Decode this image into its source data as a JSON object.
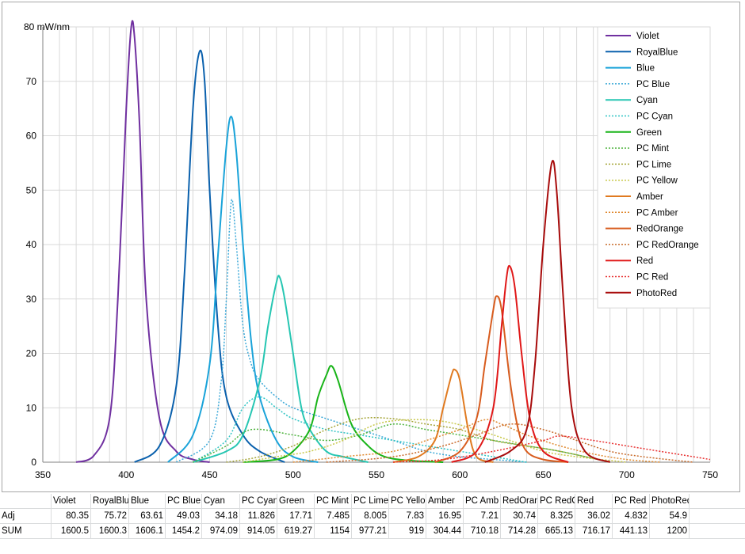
{
  "chart_data": {
    "type": "line",
    "title": "",
    "xlabel": "",
    "ylabel": "mW/nm",
    "y_top_tick_label": "80 mW/nm",
    "xlim": [
      350,
      750
    ],
    "ylim": [
      0,
      80
    ],
    "x_ticks": [
      "350",
      "400",
      "450",
      "500",
      "550",
      "600",
      "650",
      "700",
      "750"
    ],
    "y_ticks": [
      "0",
      "10",
      "20",
      "30",
      "40",
      "50",
      "60",
      "70",
      "80 mW/nm"
    ],
    "grid": true,
    "legend_position": "top-right",
    "series": [
      {
        "name": "Violet",
        "color": "#7030a0",
        "dash": "solid",
        "x": [
          370,
          380,
          390,
          395,
          400,
          403,
          405,
          408,
          412,
          420,
          430,
          440,
          450
        ],
        "y": [
          0,
          1,
          8,
          30,
          65,
          80,
          78,
          62,
          30,
          8,
          2,
          0.5,
          0
        ]
      },
      {
        "name": "RoyalBlue",
        "color": "#0b61ad",
        "dash": "solid",
        "x": [
          405,
          420,
          430,
          435,
          440,
          444,
          447,
          450,
          455,
          460,
          470,
          480,
          495
        ],
        "y": [
          0,
          3,
          14,
          35,
          65,
          75.5,
          70,
          50,
          25,
          12,
          5,
          2,
          0
        ]
      },
      {
        "name": "Blue",
        "color": "#1aa3d9",
        "dash": "solid",
        "x": [
          425,
          440,
          450,
          455,
          460,
          463,
          466,
          470,
          475,
          480,
          490,
          500,
          515
        ],
        "y": [
          0,
          5,
          18,
          38,
          58,
          63.5,
          57,
          40,
          22,
          12,
          4,
          1,
          0
        ]
      },
      {
        "name": "PC Blue",
        "color": "#3da9d8",
        "dash": "dotted",
        "x": [
          430,
          450,
          457,
          460,
          463,
          466,
          470,
          475,
          480,
          490,
          500,
          520,
          540,
          560,
          580,
          600,
          620,
          640
        ],
        "y": [
          0,
          4,
          15,
          30,
          48,
          40,
          25,
          18,
          15,
          12,
          10,
          8,
          6,
          4,
          2,
          1,
          0.5,
          0
        ]
      },
      {
        "name": "Cyan",
        "color": "#26c6b2",
        "dash": "solid",
        "x": [
          440,
          460,
          470,
          480,
          485,
          490,
          492,
          495,
          500,
          505,
          510,
          520,
          530,
          545
        ],
        "y": [
          0,
          2,
          5,
          15,
          25,
          33,
          34,
          30,
          20,
          10,
          6,
          2,
          1,
          0
        ]
      },
      {
        "name": "PC Cyan",
        "color": "#2ec4c4",
        "dash": "dotted",
        "x": [
          440,
          460,
          470,
          480,
          490,
          500,
          520,
          540,
          560,
          580,
          600,
          620,
          640
        ],
        "y": [
          0,
          4,
          10,
          12,
          10,
          8,
          6,
          5,
          4,
          3,
          2,
          1,
          0
        ]
      },
      {
        "name": "Green",
        "color": "#18b418",
        "dash": "solid",
        "x": [
          470,
          490,
          500,
          510,
          515,
          520,
          523,
          527,
          535,
          545,
          555,
          570,
          590
        ],
        "y": [
          0,
          0.5,
          2,
          6,
          12,
          16,
          17.7,
          15,
          7,
          3,
          1,
          0.3,
          0
        ]
      },
      {
        "name": "PC Mint",
        "color": "#4db33d",
        "dash": "dotted",
        "x": [
          440,
          460,
          475,
          500,
          520,
          540,
          560,
          580,
          600,
          620,
          640,
          660,
          690
        ],
        "y": [
          0,
          3,
          6,
          5,
          4,
          5,
          7,
          6,
          5,
          4,
          3,
          2,
          0
        ]
      },
      {
        "name": "PC Lime",
        "color": "#a6a63a",
        "dash": "dotted",
        "x": [
          460,
          480,
          500,
          520,
          540,
          560,
          580,
          600,
          620,
          640,
          660,
          690
        ],
        "y": [
          0,
          1,
          3,
          6,
          8,
          8,
          7,
          6,
          4,
          3,
          2,
          0
        ]
      },
      {
        "name": "PC Yellow",
        "color": "#c8c84a",
        "dash": "dotted",
        "x": [
          470,
          490,
          510,
          530,
          550,
          570,
          590,
          610,
          630,
          650,
          670,
          700
        ],
        "y": [
          0,
          1,
          2,
          4,
          7,
          7.8,
          7.5,
          6,
          4,
          2,
          1,
          0
        ]
      },
      {
        "name": "Amber",
        "color": "#e07a20",
        "dash": "solid",
        "x": [
          560,
          575,
          585,
          590,
          595,
          597,
          600,
          605,
          610,
          620
        ],
        "y": [
          0,
          1,
          4,
          10,
          16,
          17,
          15,
          6,
          1,
          0
        ]
      },
      {
        "name": "PC Amber",
        "color": "#e08a30",
        "dash": "dotted",
        "x": [
          500,
          530,
          560,
          580,
          600,
          615,
          625,
          640,
          660,
          680,
          700,
          720
        ],
        "y": [
          0,
          1,
          2,
          4,
          6,
          7.8,
          7,
          5,
          3,
          1.5,
          0.5,
          0
        ]
      },
      {
        "name": "RedOrange",
        "color": "#d85c1e",
        "dash": "solid",
        "x": [
          585,
          600,
          610,
          615,
          620,
          622,
          625,
          630,
          635,
          640,
          650,
          665
        ],
        "y": [
          0,
          2,
          8,
          18,
          28,
          30.5,
          28,
          15,
          6,
          2,
          0.5,
          0
        ]
      },
      {
        "name": "PC RedOrange",
        "color": "#c86a2a",
        "dash": "dotted",
        "x": [
          520,
          560,
          590,
          610,
          630,
          650,
          670,
          690,
          710,
          740
        ],
        "y": [
          0,
          1,
          3,
          5,
          7,
          6,
          4,
          2,
          1,
          0
        ]
      },
      {
        "name": "Red",
        "color": "#e01818",
        "dash": "solid",
        "x": [
          595,
          610,
          620,
          625,
          628,
          630,
          633,
          637,
          642,
          650,
          665
        ],
        "y": [
          0,
          2,
          10,
          25,
          34,
          36,
          32,
          20,
          8,
          2,
          0
        ]
      },
      {
        "name": "PC Red",
        "color": "#e83030",
        "dash": "dotted",
        "x": [
          560,
          590,
          620,
          650,
          660,
          680,
          700,
          720,
          740,
          750
        ],
        "y": [
          0,
          0.5,
          2,
          4,
          4.8,
          4,
          3,
          2,
          1,
          0.5
        ]
      },
      {
        "name": "PhotoRed",
        "color": "#a80c0c",
        "dash": "solid",
        "x": [
          615,
          630,
          640,
          645,
          650,
          655,
          658,
          662,
          667,
          675,
          690
        ],
        "y": [
          0,
          2,
          6,
          18,
          40,
          54.9,
          50,
          30,
          10,
          2,
          0
        ]
      }
    ]
  },
  "table": {
    "row_labels": [
      "",
      "Adj",
      "SUM"
    ],
    "headers": [
      "Violet",
      "RoyalBlu",
      "Blue",
      "PC Blue",
      "Cyan",
      "PC Cyan",
      "Green",
      "PC Mint",
      "PC Lime",
      "PC Yello",
      "Amber",
      "PC Amb",
      "RedOran",
      "PC RedO",
      "Red",
      "PC Red",
      "PhotoRed"
    ],
    "adj": [
      "80.35",
      "75.72",
      "63.61",
      "49.03",
      "34.18",
      "11.826",
      "17.71",
      "7.485",
      "8.005",
      "7.83",
      "16.95",
      "7.21",
      "30.74",
      "8.325",
      "36.02",
      "4.832",
      "54.9"
    ],
    "sum": [
      "1600.5",
      "1600.3",
      "1606.1",
      "1454.2",
      "974.09",
      "914.05",
      "619.27",
      "1154",
      "977.21",
      "919",
      "304.44",
      "710.18",
      "714.28",
      "665.13",
      "716.17",
      "441.13",
      "1200"
    ]
  }
}
